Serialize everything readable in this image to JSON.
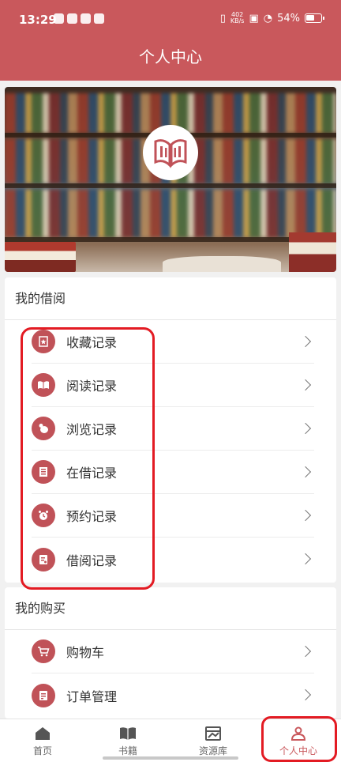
{
  "status_bar": {
    "time": "13:29",
    "net_speed_value": "402",
    "net_speed_unit": "KB/s",
    "battery": "54%"
  },
  "header": {
    "title": "个人中心"
  },
  "sections": [
    {
      "title": "我的借阅",
      "items": [
        {
          "label": "收藏记录",
          "icon": "favorite-icon"
        },
        {
          "label": "阅读记录",
          "icon": "open-book-icon"
        },
        {
          "label": "浏览记录",
          "icon": "browse-icon"
        },
        {
          "label": "在借记录",
          "icon": "borrowing-icon"
        },
        {
          "label": "预约记录",
          "icon": "alarm-clock-icon"
        },
        {
          "label": "借阅记录",
          "icon": "borrow-history-icon"
        }
      ]
    },
    {
      "title": "我的购买",
      "items": [
        {
          "label": "购物车",
          "icon": "shopping-cart-icon"
        },
        {
          "label": "订单管理",
          "icon": "order-icon"
        }
      ]
    }
  ],
  "tabbar": {
    "tabs": [
      {
        "label": "首页",
        "icon": "home-icon",
        "active": false
      },
      {
        "label": "书籍",
        "icon": "book-icon",
        "active": false
      },
      {
        "label": "资源库",
        "icon": "resource-icon",
        "active": false
      },
      {
        "label": "个人中心",
        "icon": "person-icon",
        "active": true
      }
    ]
  },
  "colors": {
    "brand": "#c9585c",
    "icon_bg": "#c05258",
    "highlight": "#e31b23"
  }
}
